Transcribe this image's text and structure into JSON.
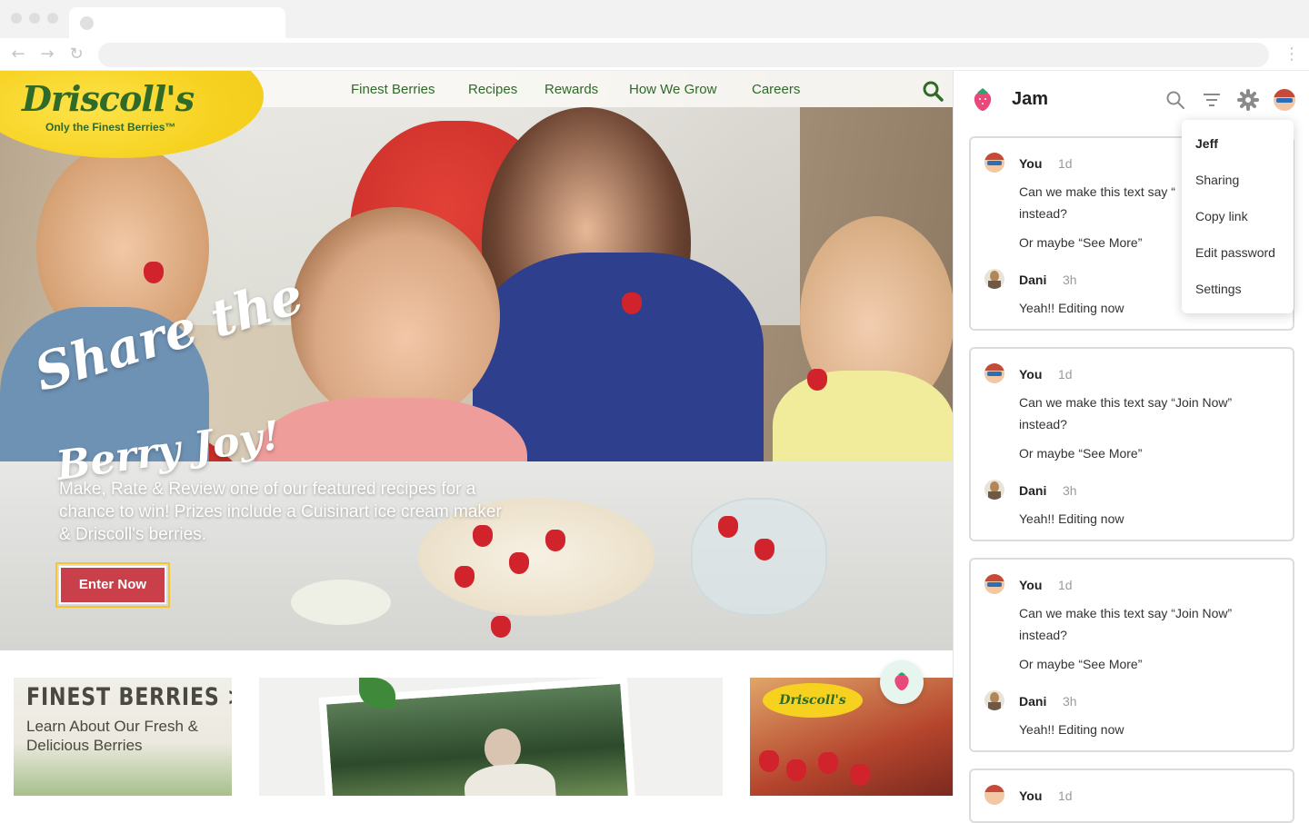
{
  "site": {
    "logo_text": "Driscoll's",
    "logo_tagline": "Only the Finest Berries™",
    "nav": [
      "Finest Berries",
      "Recipes",
      "Rewards",
      "How We Grow",
      "Careers"
    ],
    "hero": {
      "headline_line1": "Share the",
      "headline_line2": "Berry Joy!",
      "body": "Make, Rate & Review one of our featured recipes for a chance to win! Prizes include a Cuisinart ice cream maker & Driscoll's berries.",
      "cta": "Enter Now"
    },
    "cards": {
      "finest_title": "FINEST BERRIES >",
      "finest_sub": "Learn About Our Fresh & Delicious Berries",
      "package_logo": "Driscoll's"
    }
  },
  "jam": {
    "title": "Jam",
    "menu": [
      "Jeff",
      "Sharing",
      "Copy link",
      "Edit password",
      "Settings"
    ],
    "threads": [
      {
        "author": "You",
        "time": "1d",
        "text": "Can we make this text say “Join Now” instead?",
        "text_visible": "Can we make this text say “",
        "text_line2": "instead?",
        "followup": "Or maybe “See More”",
        "reply_author": "Dani",
        "reply_time": "3h",
        "reply_text": "Yeah!! Editing now"
      },
      {
        "author": "You",
        "time": "1d",
        "text_line1": "Can we make this text say “Join Now”",
        "text_line2": "instead?",
        "followup": "Or maybe “See More”",
        "reply_author": "Dani",
        "reply_time": "3h",
        "reply_text": "Yeah!! Editing now"
      },
      {
        "author": "You",
        "time": "1d",
        "text_line1": "Can we make this text say “Join Now”",
        "text_line2": "instead?",
        "followup": "Or maybe “See More”",
        "reply_author": "Dani",
        "reply_time": "3h",
        "reply_text": "Yeah!! Editing now"
      },
      {
        "author": "You",
        "time": "1d"
      }
    ]
  },
  "colors": {
    "brand_green": "#2f6a29",
    "brand_yellow": "#f6d11f",
    "berry_red": "#d1232b",
    "cta_red": "#c9404a",
    "jam_pink": "#e8487a"
  },
  "icons": [
    "back-arrow-icon",
    "forward-arrow-icon",
    "reload-icon",
    "kebab-menu-icon",
    "search-icon",
    "filter-icon",
    "gear-icon",
    "jam-strawberry-icon"
  ]
}
